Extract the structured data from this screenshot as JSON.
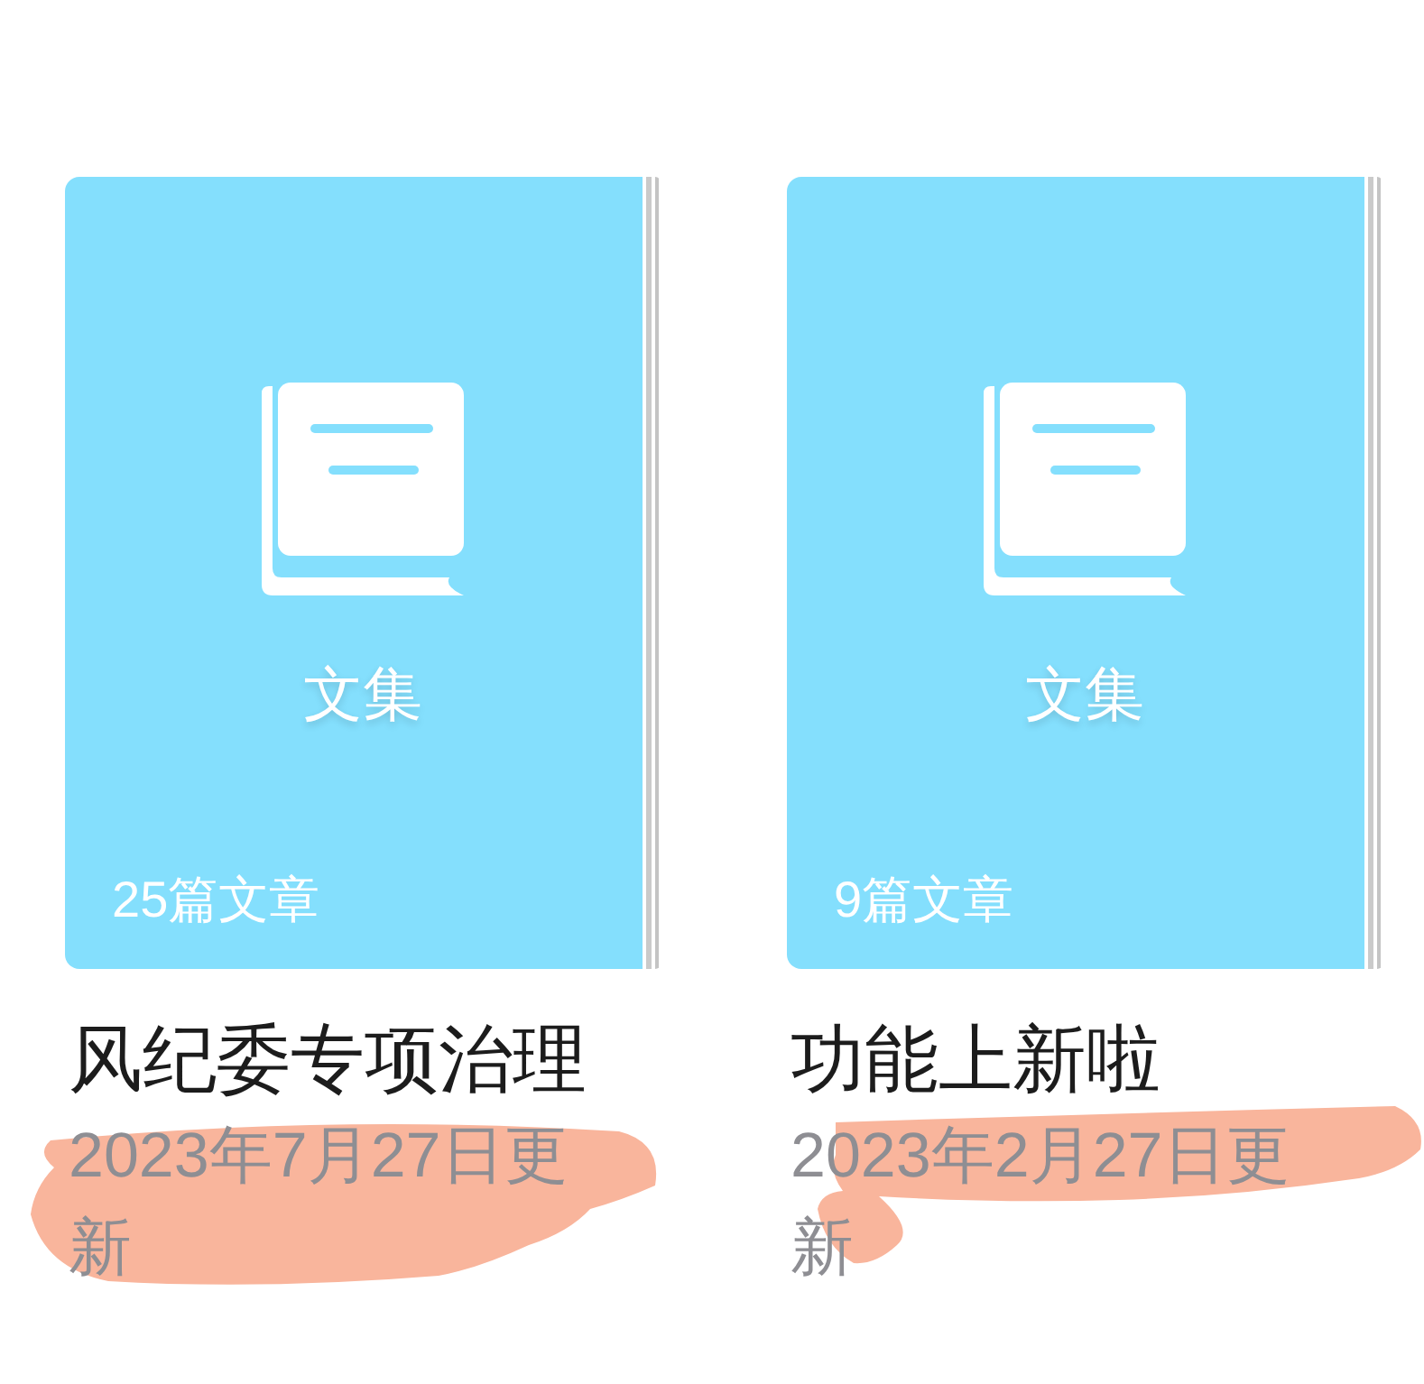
{
  "collections": [
    {
      "cover_label": "文集",
      "article_count": "25篇文章",
      "title": "风纪委专项治理",
      "updated": "2023年7月27日更新",
      "highlighter_mark": true
    },
    {
      "cover_label": "文集",
      "article_count": "9篇文章",
      "title": "功能上新啦",
      "updated": "2023年2月27日更新",
      "highlighter_mark": true
    }
  ]
}
